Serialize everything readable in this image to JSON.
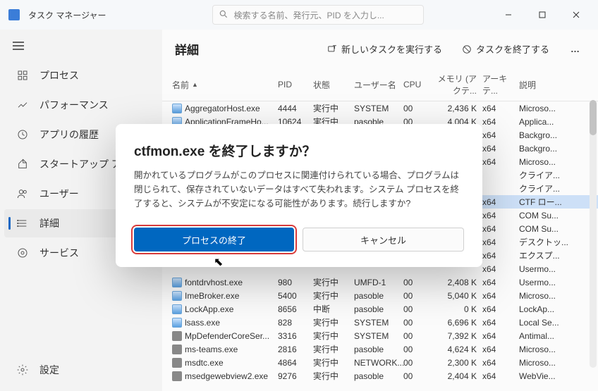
{
  "app": {
    "title": "タスク マネージャー"
  },
  "search": {
    "placeholder": "検索する名前、発行元、PID を入力し..."
  },
  "sidebar": {
    "items": [
      "プロセス",
      "パフォーマンス",
      "アプリの履歴",
      "スタートアップ アプリ",
      "ユーザー",
      "詳細",
      "サービス"
    ],
    "settings": "設定",
    "active_index": 5
  },
  "toolbar": {
    "title": "詳細",
    "new_task": "新しいタスクを実行する",
    "end_task": "タスクを終了する"
  },
  "columns": [
    "名前",
    "PID",
    "状態",
    "ユーザー名",
    "CPU",
    "メモリ (アクテ...",
    "アーキテ...",
    "説明"
  ],
  "rows": [
    {
      "name": "AggregatorHost.exe",
      "pid": "4444",
      "status": "実行中",
      "user": "SYSTEM",
      "cpu": "00",
      "mem": "2,436 K",
      "arch": "x64",
      "desc": "Microso...",
      "icon": "generic"
    },
    {
      "name": "ApplicationFrameHo...",
      "pid": "10624",
      "status": "実行中",
      "user": "pasoble",
      "cpu": "00",
      "mem": "4,004 K",
      "arch": "x64",
      "desc": "Applica...",
      "icon": "generic"
    },
    {
      "name": "",
      "pid": "",
      "status": "",
      "user": "",
      "cpu": "",
      "mem": "",
      "arch": "x64",
      "desc": "Backgro...",
      "hidden": true
    },
    {
      "name": "",
      "pid": "",
      "status": "",
      "user": "",
      "cpu": "",
      "mem": "",
      "arch": "x64",
      "desc": "Backgro...",
      "hidden": true
    },
    {
      "name": "",
      "pid": "",
      "status": "",
      "user": "",
      "cpu": "",
      "mem": "",
      "arch": "x64",
      "desc": "Microso...",
      "hidden": true
    },
    {
      "name": "",
      "pid": "",
      "status": "",
      "user": "",
      "cpu": "",
      "mem": "",
      "arch": "",
      "desc": "クライア...",
      "hidden": true
    },
    {
      "name": "",
      "pid": "",
      "status": "",
      "user": "",
      "cpu": "",
      "mem": "",
      "arch": "",
      "desc": "クライア...",
      "hidden": true
    },
    {
      "name": "",
      "pid": "",
      "status": "",
      "user": "",
      "cpu": "",
      "mem": "",
      "arch": "x64",
      "desc": "CTF ロー...",
      "hidden": true,
      "selected": true
    },
    {
      "name": "",
      "pid": "",
      "status": "",
      "user": "",
      "cpu": "",
      "mem": "",
      "arch": "x64",
      "desc": "COM Su...",
      "hidden": true
    },
    {
      "name": "",
      "pid": "",
      "status": "",
      "user": "",
      "cpu": "",
      "mem": "",
      "arch": "x64",
      "desc": "COM Su...",
      "hidden": true
    },
    {
      "name": "",
      "pid": "",
      "status": "",
      "user": "",
      "cpu": "",
      "mem": "",
      "arch": "x64",
      "desc": "デスクトッ...",
      "hidden": true
    },
    {
      "name": "",
      "pid": "",
      "status": "",
      "user": "",
      "cpu": "",
      "mem": "",
      "arch": "x64",
      "desc": "エクスプ...",
      "hidden": true
    },
    {
      "name": "",
      "pid": "",
      "status": "",
      "user": "",
      "cpu": "",
      "mem": "",
      "arch": "x64",
      "desc": "Usermo...",
      "hidden": true
    },
    {
      "name": "fontdrvhost.exe",
      "pid": "980",
      "status": "実行中",
      "user": "UMFD-1",
      "cpu": "00",
      "mem": "2,408 K",
      "arch": "x64",
      "desc": "Usermo...",
      "icon": "generic"
    },
    {
      "name": "ImeBroker.exe",
      "pid": "5400",
      "status": "実行中",
      "user": "pasoble",
      "cpu": "00",
      "mem": "5,040 K",
      "arch": "x64",
      "desc": "Microso...",
      "icon": "generic"
    },
    {
      "name": "LockApp.exe",
      "pid": "8656",
      "status": "中断",
      "user": "pasoble",
      "cpu": "00",
      "mem": "0 K",
      "arch": "x64",
      "desc": "LockAp...",
      "icon": "generic"
    },
    {
      "name": "lsass.exe",
      "pid": "828",
      "status": "実行中",
      "user": "SYSTEM",
      "cpu": "00",
      "mem": "6,696 K",
      "arch": "x64",
      "desc": "Local Se...",
      "icon": "generic"
    },
    {
      "name": "MpDefenderCoreSer...",
      "pid": "3316",
      "status": "実行中",
      "user": "SYSTEM",
      "cpu": "00",
      "mem": "7,392 K",
      "arch": "x64",
      "desc": "Antimal...",
      "icon": "other"
    },
    {
      "name": "ms-teams.exe",
      "pid": "2816",
      "status": "実行中",
      "user": "pasoble",
      "cpu": "00",
      "mem": "4,624 K",
      "arch": "x64",
      "desc": "Microso...",
      "icon": "other"
    },
    {
      "name": "msdtc.exe",
      "pid": "4864",
      "status": "実行中",
      "user": "NETWORK...",
      "cpu": "00",
      "mem": "2,300 K",
      "arch": "x64",
      "desc": "Microso...",
      "icon": "other"
    },
    {
      "name": "msedgewebview2.exe",
      "pid": "9276",
      "status": "実行中",
      "user": "pasoble",
      "cpu": "00",
      "mem": "2,404 K",
      "arch": "x64",
      "desc": "WebVie...",
      "icon": "other"
    }
  ],
  "dialog": {
    "title": "ctfmon.exe を終了しますか？",
    "text": "開かれているプログラムがこのプロセスに関連付けられている場合、プログラムは閉じられて、保存されていないデータはすべて失われます。システム プロセスを終了すると、システムが不安定になる可能性があります。続行しますか?",
    "primary": "プロセスの終了",
    "secondary": "キャンセル"
  }
}
